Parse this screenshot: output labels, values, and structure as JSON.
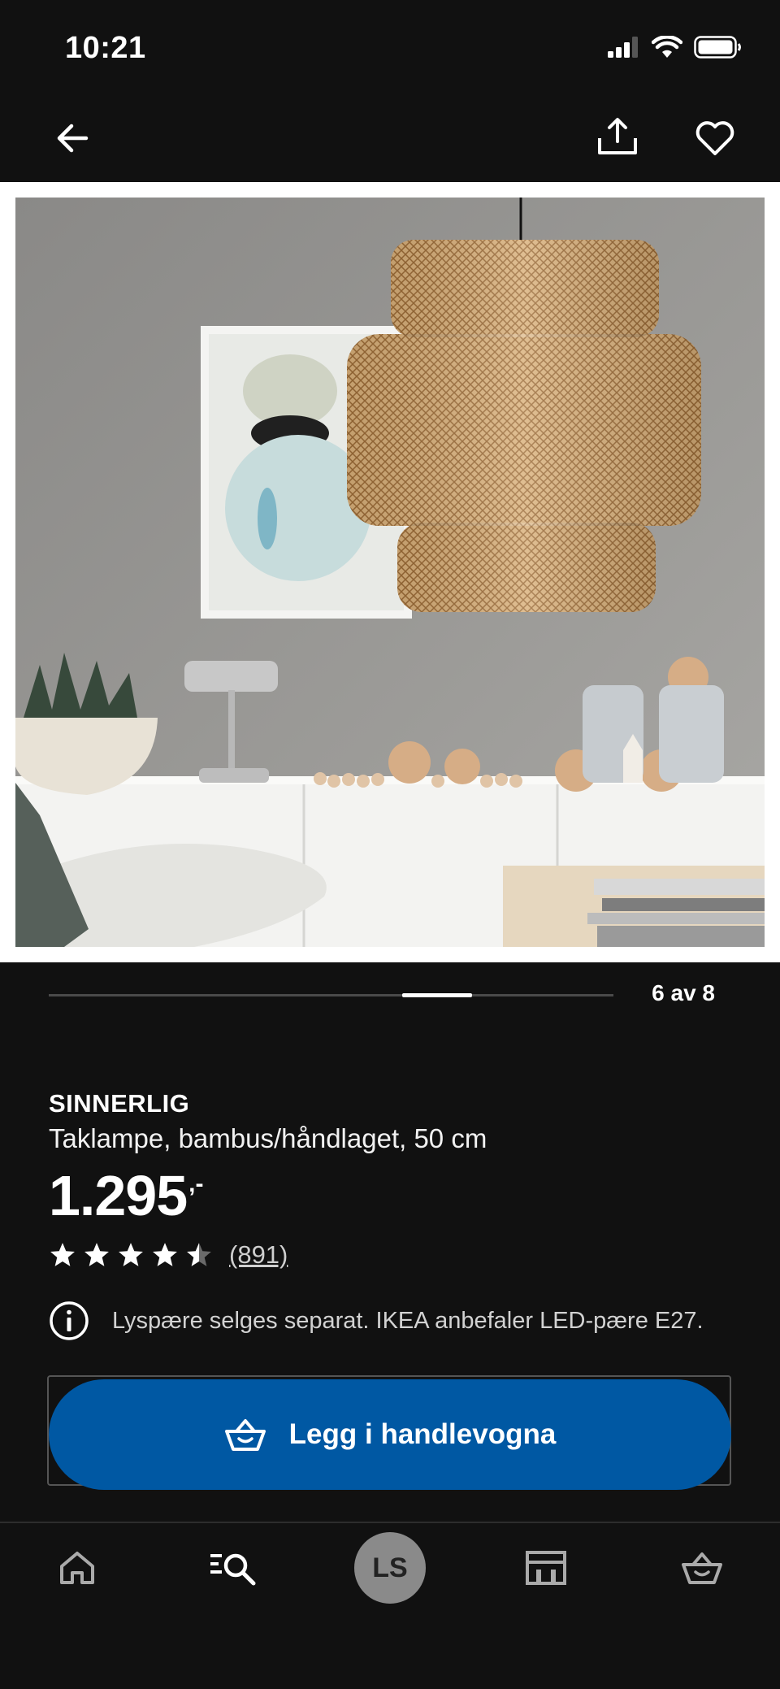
{
  "status_bar": {
    "time": "10:21"
  },
  "product": {
    "name": "SINNERLIG",
    "description": "Taklampe, bambus/håndlaget, 50 cm",
    "price_integer": "1.295",
    "price_decimal": ",-",
    "rating": 4.5,
    "rating_max": 5,
    "review_count": "(891)",
    "info_text": "Lyspære selges separat. IKEA anbefaler LED-pære E27."
  },
  "gallery": {
    "counter": "6 av 8",
    "current": 6,
    "total": 8
  },
  "cart_button": {
    "label": "Legg i handlevogna"
  },
  "tabbar": {
    "avatar_initials": "LS"
  },
  "colors": {
    "background": "#111111",
    "accent": "#0058a3"
  }
}
